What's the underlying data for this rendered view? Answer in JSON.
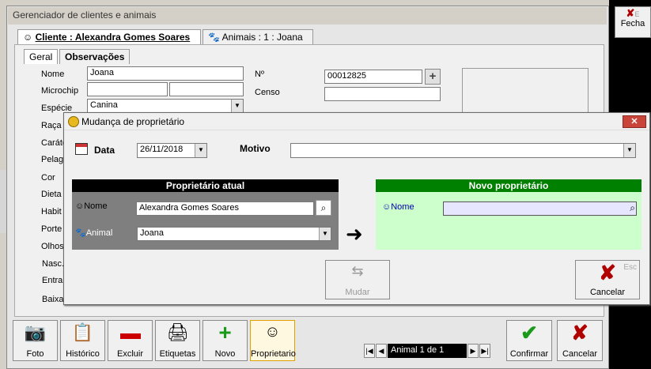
{
  "main_window": {
    "title": "Gerenciador de clientes e animais"
  },
  "right_button": {
    "label": "Fecha",
    "hint": "E"
  },
  "tabs": {
    "client": "Cliente : Alexandra Gomes Soares",
    "animals": "Animais : 1 : Joana"
  },
  "subtabs": {
    "general": "Geral",
    "notes": "Observações"
  },
  "form": {
    "labels": [
      "Nome",
      "Microchip",
      "Espécie",
      "Raça",
      "Caráte",
      "Pelag",
      "Cor",
      "Dieta",
      "Habit",
      "Porte",
      "Olhos",
      "Nasc.",
      "Entra",
      "Baixa"
    ],
    "nome_value": "Joana",
    "especie_value": "Canina",
    "numero_label": "Nº",
    "numero_value": "00012825",
    "censo_label": "Censo"
  },
  "dialog": {
    "title": "Mudança de proprietário",
    "close_label": "✕",
    "data_label": "Data",
    "data_value": "26/11/2018",
    "motivo_label": "Motivo",
    "motivo_value": "",
    "current_owner_header": "Proprietário atual",
    "new_owner_header": "Novo proprietário",
    "current_nome_label": "Nome",
    "current_nome_value": "Alexandra Gomes Soares",
    "current_animal_label": "Animal",
    "current_animal_value": "Joana",
    "new_nome_label": "Nome",
    "new_nome_value": "",
    "mudar_label": "Mudar",
    "cancelar_label": "Cancelar",
    "esc_label": "Esc"
  },
  "toolbar": {
    "foto": "Foto",
    "historico": "Histórico",
    "excluir": "Excluir",
    "etiquetas": "Etiquetas",
    "novo": "Novo",
    "proprietario": "Proprietario",
    "confirmar": "Confirmar",
    "cancelar": "Cancelar"
  },
  "navigator": {
    "text": "Animal 1 de 1"
  },
  "colors": {
    "old_header": "#000000",
    "new_header": "#008000",
    "new_panel": "#ccffcc",
    "old_panel": "#7f7f7f"
  }
}
